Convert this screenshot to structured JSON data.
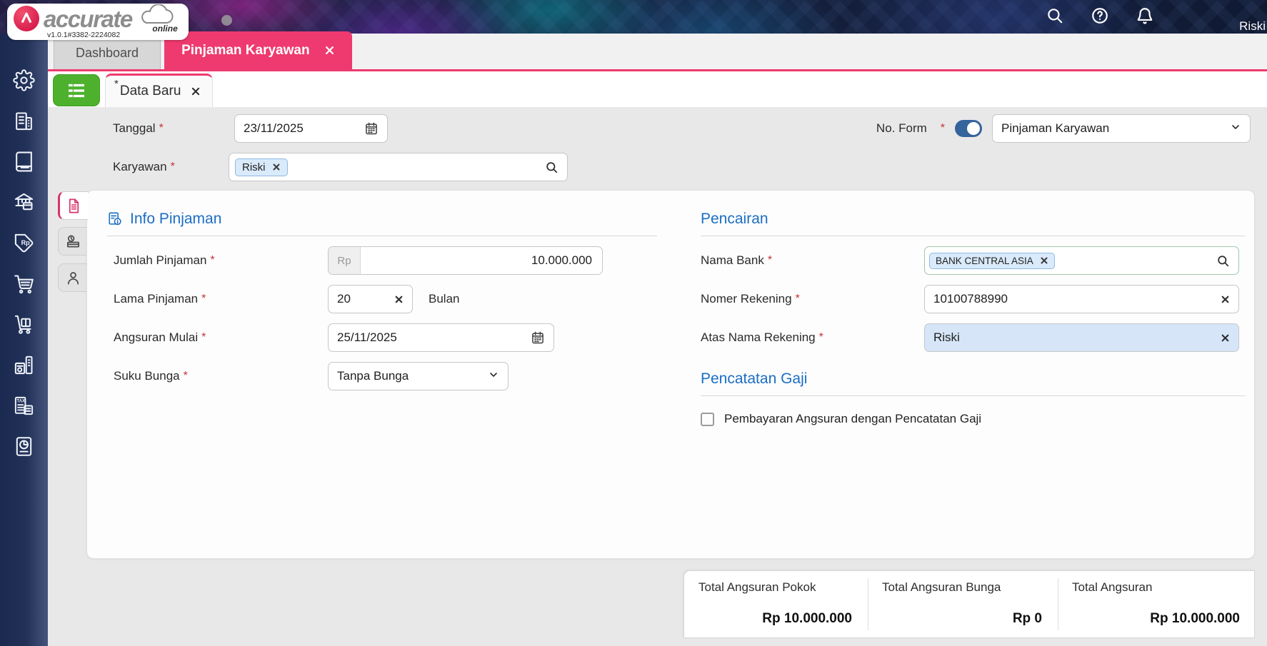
{
  "brand": {
    "name": "accurate",
    "sub": "online",
    "version": "v1.0.1#3382-2224082"
  },
  "topbar": {
    "user": "Riski",
    "icons": [
      "search-icon",
      "help-icon",
      "notifications-icon"
    ]
  },
  "tabs": {
    "items": [
      {
        "label": "Dashboard",
        "active": false
      },
      {
        "label": "Pinjaman Karyawan",
        "active": true
      }
    ]
  },
  "subtab": {
    "mark": "*",
    "label": "Data Baru"
  },
  "required_mark": "*",
  "header_form": {
    "tanggal_label": "Tanggal",
    "tanggal_value": "23/11/2025",
    "karyawan_label": "Karyawan",
    "karyawan_chip": "Riski",
    "no_form_label": "No. Form",
    "no_form_toggle_on": true,
    "no_form_value": "Pinjaman Karyawan"
  },
  "info_pinjaman": {
    "title": "Info Pinjaman",
    "jumlah_label": "Jumlah Pinjaman",
    "jumlah_prefix": "Rp",
    "jumlah_value": "10.000.000",
    "lama_label": "Lama Pinjaman",
    "lama_value": "20",
    "lama_suffix": "Bulan",
    "angsuran_label": "Angsuran Mulai",
    "angsuran_value": "25/11/2025",
    "suku_label": "Suku Bunga",
    "suku_value": "Tanpa Bunga"
  },
  "pencairan": {
    "title": "Pencairan",
    "bank_label": "Nama Bank",
    "bank_chip": "BANK CENTRAL ASIA",
    "rekening_label": "Nomer Rekening",
    "rekening_value": "10100788990",
    "atas_nama_label": "Atas Nama Rekening",
    "atas_nama_value": "Riski"
  },
  "pencatatan": {
    "title": "Pencatatan Gaji",
    "checkbox_label": "Pembayaran Angsuran dengan Pencatatan Gaji",
    "checked": false
  },
  "totals": [
    {
      "label": "Total Angsuran Pokok",
      "value": "Rp 10.000.000"
    },
    {
      "label": "Total Angsuran Bunga",
      "value": "Rp 0"
    },
    {
      "label": "Total Angsuran",
      "value": "Rp 10.000.000"
    }
  ],
  "sidebar_icons": [
    "settings",
    "company",
    "ledger",
    "cash-bank",
    "sales",
    "purchases",
    "inventory",
    "fixed-assets",
    "tax",
    "reports"
  ],
  "side_panel_tabs": [
    "detail-document",
    "payment-history",
    "employee"
  ],
  "colors": {
    "accent_pink": "#ee3a6e",
    "accent_green": "#4db12e",
    "accent_blue": "#1b6ec2",
    "toggle_blue": "#35639c",
    "sidebar_navy": "#1b2950"
  }
}
